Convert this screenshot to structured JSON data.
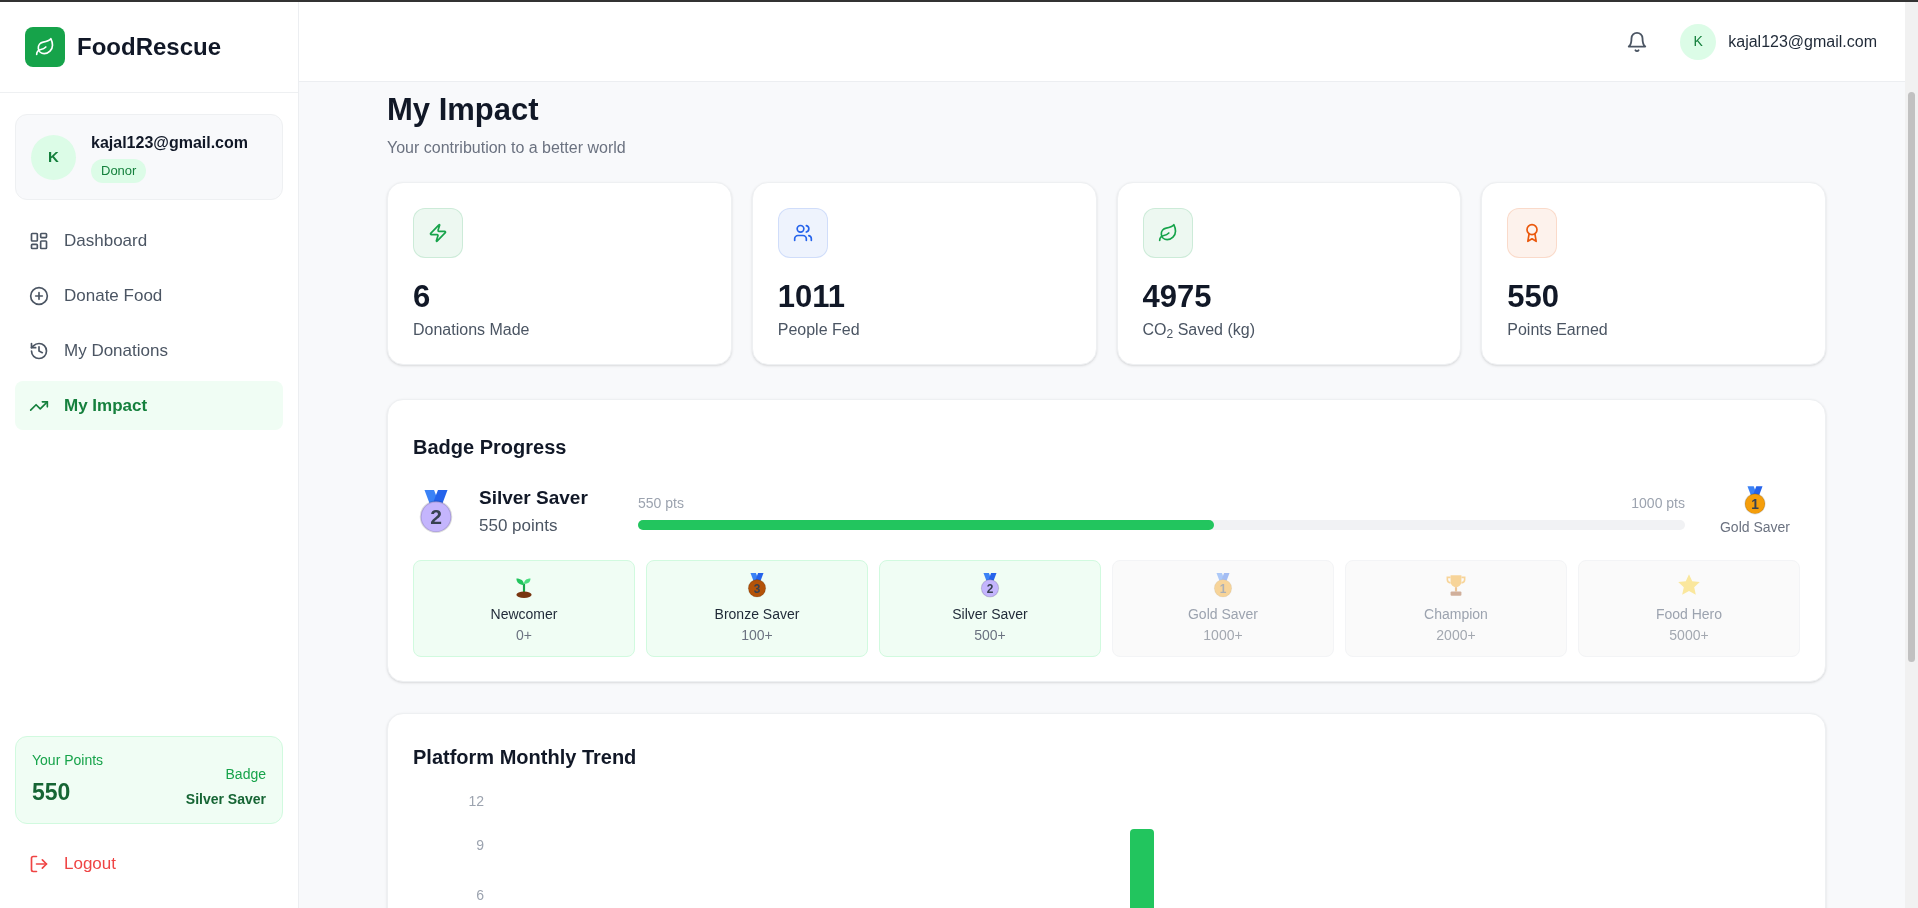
{
  "brand": {
    "name": "FoodRescue"
  },
  "user_card": {
    "avatar": "K",
    "email": "kajal123@gmail.com",
    "role": "Donor"
  },
  "nav": [
    {
      "label": "Dashboard",
      "selected": false
    },
    {
      "label": "Donate Food",
      "selected": false
    },
    {
      "label": "My Donations",
      "selected": false
    },
    {
      "label": "My Impact",
      "selected": true
    }
  ],
  "points_card": {
    "label": "Your Points",
    "points": "550",
    "badge_label": "Badge",
    "badge": "Silver Saver"
  },
  "logout": "Logout",
  "header": {
    "avatar": "K",
    "email": "kajal123@gmail.com"
  },
  "page": {
    "title": "My Impact",
    "subtitle": "Your contribution to a better world"
  },
  "stats": [
    {
      "value": "6",
      "label": "Donations Made",
      "color": "#16a34a"
    },
    {
      "value": "1011",
      "label": "People Fed",
      "color": "#2563eb"
    },
    {
      "value": "4975",
      "label": "CO$_{2}$ Saved (kg)",
      "color": "#16a34a"
    },
    {
      "value": "550",
      "label": "Points Earned",
      "color": "#ea580c"
    }
  ],
  "badge_progress": {
    "title": "Badge Progress",
    "current": {
      "medal": "2",
      "name": "Silver Saver",
      "points": "550 points"
    },
    "start": "550 pts",
    "end": "1000 pts",
    "level": 0.55,
    "next": {
      "medal": "1",
      "name": "Gold Saver"
    }
  },
  "badges": [
    {
      "kind": "sprout",
      "name": "Newcomer",
      "threshold": "0+",
      "unlocked": true
    },
    {
      "kind": "medal",
      "medal": "3",
      "name": "Bronze Saver",
      "threshold": "100+",
      "unlocked": true
    },
    {
      "kind": "medal",
      "medal": "2",
      "name": "Silver Saver",
      "threshold": "500+",
      "unlocked": true
    },
    {
      "kind": "medal",
      "medal": "1",
      "name": "Gold Saver",
      "threshold": "1000+",
      "unlocked": false
    },
    {
      "kind": "trophy",
      "name": "Champion",
      "threshold": "2000+",
      "unlocked": false
    },
    {
      "kind": "star",
      "name": "Food Hero",
      "threshold": "5000+",
      "unlocked": false
    }
  ],
  "trend": {
    "title": "Platform Monthly Trend",
    "axis_labels": [
      "12",
      "9",
      "6"
    ]
  }
}
